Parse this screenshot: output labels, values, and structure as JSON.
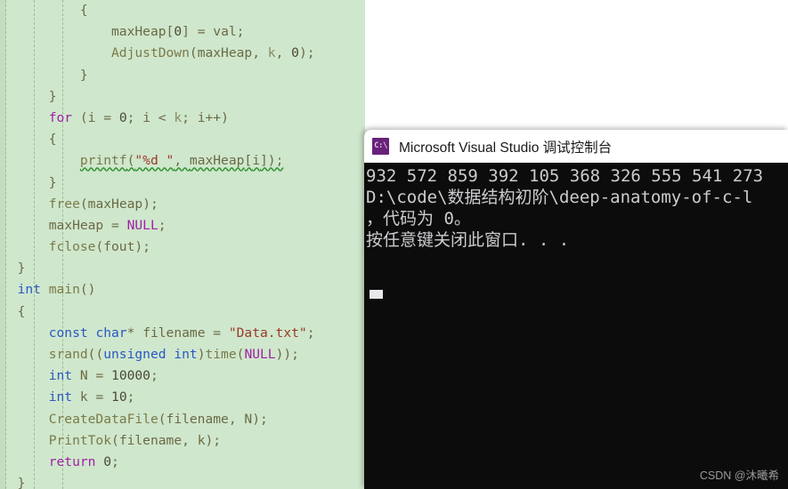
{
  "editor": {
    "name": "visual-studio-code-editor",
    "background_color": "#cfe7cc",
    "lines": [
      {
        "indent": 5,
        "segments": [
          {
            "t": "{",
            "c": "brace"
          }
        ]
      },
      {
        "indent": 7,
        "segments": [
          {
            "t": "maxHeap",
            "c": "id"
          },
          {
            "t": "[",
            "c": "punc"
          },
          {
            "t": "0",
            "c": "num"
          },
          {
            "t": "] = ",
            "c": "punc"
          },
          {
            "t": "val",
            "c": "id"
          },
          {
            "t": ";",
            "c": "punc"
          }
        ]
      },
      {
        "indent": 7,
        "segments": [
          {
            "t": "AdjustDown",
            "c": "fn"
          },
          {
            "t": "(",
            "c": "punc"
          },
          {
            "t": "maxHeap",
            "c": "id"
          },
          {
            "t": ", ",
            "c": "punc"
          },
          {
            "t": "k",
            "c": "param"
          },
          {
            "t": ", ",
            "c": "punc"
          },
          {
            "t": "0",
            "c": "num"
          },
          {
            "t": ");",
            "c": "punc"
          }
        ]
      },
      {
        "indent": 5,
        "segments": [
          {
            "t": "}",
            "c": "brace"
          }
        ]
      },
      {
        "indent": 3,
        "segments": [
          {
            "t": "}",
            "c": "brace"
          }
        ]
      },
      {
        "indent": 3,
        "segments": [
          {
            "t": "for",
            "c": "kw"
          },
          {
            "t": " (",
            "c": "punc"
          },
          {
            "t": "i",
            "c": "id"
          },
          {
            "t": " = ",
            "c": "punc"
          },
          {
            "t": "0",
            "c": "num"
          },
          {
            "t": "; ",
            "c": "punc"
          },
          {
            "t": "i",
            "c": "id"
          },
          {
            "t": " < ",
            "c": "punc"
          },
          {
            "t": "k",
            "c": "param"
          },
          {
            "t": "; ",
            "c": "punc"
          },
          {
            "t": "i",
            "c": "id"
          },
          {
            "t": "++)",
            "c": "punc"
          }
        ]
      },
      {
        "indent": 3,
        "segments": [
          {
            "t": "{",
            "c": "brace"
          }
        ]
      },
      {
        "indent": 5,
        "squiggle": true,
        "segments": [
          {
            "t": "printf",
            "c": "fn"
          },
          {
            "t": "(",
            "c": "punc"
          },
          {
            "t": "\"%d \"",
            "c": "str"
          },
          {
            "t": ", ",
            "c": "punc"
          },
          {
            "t": "maxHeap",
            "c": "id"
          },
          {
            "t": "[",
            "c": "punc"
          },
          {
            "t": "i",
            "c": "id"
          },
          {
            "t": "]);",
            "c": "punc"
          }
        ]
      },
      {
        "indent": 3,
        "segments": [
          {
            "t": "}",
            "c": "brace"
          }
        ]
      },
      {
        "indent": 3,
        "segments": [
          {
            "t": "free",
            "c": "fn"
          },
          {
            "t": "(",
            "c": "punc"
          },
          {
            "t": "maxHeap",
            "c": "id"
          },
          {
            "t": ");",
            "c": "punc"
          }
        ]
      },
      {
        "indent": 3,
        "segments": [
          {
            "t": "maxHeap",
            "c": "id"
          },
          {
            "t": " = ",
            "c": "punc"
          },
          {
            "t": "NULL",
            "c": "kw"
          },
          {
            "t": ";",
            "c": "punc"
          }
        ]
      },
      {
        "indent": 3,
        "segments": [
          {
            "t": "fclose",
            "c": "fn"
          },
          {
            "t": "(",
            "c": "punc"
          },
          {
            "t": "fout",
            "c": "id"
          },
          {
            "t": ");",
            "c": "punc"
          }
        ]
      },
      {
        "indent": 1,
        "segments": [
          {
            "t": "}",
            "c": "brace"
          }
        ]
      },
      {
        "indent": 1,
        "segments": [
          {
            "t": "int",
            "c": "type"
          },
          {
            "t": " ",
            "c": "punc"
          },
          {
            "t": "main",
            "c": "fn"
          },
          {
            "t": "()",
            "c": "punc"
          }
        ]
      },
      {
        "indent": 1,
        "segments": [
          {
            "t": "{",
            "c": "brace"
          }
        ]
      },
      {
        "indent": 3,
        "segments": [
          {
            "t": "const",
            "c": "type"
          },
          {
            "t": " ",
            "c": "punc"
          },
          {
            "t": "char",
            "c": "type"
          },
          {
            "t": "* ",
            "c": "punc"
          },
          {
            "t": "filename",
            "c": "id"
          },
          {
            "t": " = ",
            "c": "punc"
          },
          {
            "t": "\"Data.txt\"",
            "c": "str"
          },
          {
            "t": ";",
            "c": "punc"
          }
        ]
      },
      {
        "indent": 3,
        "segments": [
          {
            "t": "srand",
            "c": "fn"
          },
          {
            "t": "((",
            "c": "punc"
          },
          {
            "t": "unsigned",
            "c": "type"
          },
          {
            "t": " ",
            "c": "punc"
          },
          {
            "t": "int",
            "c": "type"
          },
          {
            "t": ")",
            "c": "punc"
          },
          {
            "t": "time",
            "c": "fn"
          },
          {
            "t": "(",
            "c": "punc"
          },
          {
            "t": "NULL",
            "c": "kw"
          },
          {
            "t": "));",
            "c": "punc"
          }
        ]
      },
      {
        "indent": 3,
        "segments": [
          {
            "t": "int",
            "c": "type"
          },
          {
            "t": " ",
            "c": "punc"
          },
          {
            "t": "N",
            "c": "id"
          },
          {
            "t": " = ",
            "c": "punc"
          },
          {
            "t": "10000",
            "c": "num"
          },
          {
            "t": ";",
            "c": "punc"
          }
        ]
      },
      {
        "indent": 3,
        "segments": [
          {
            "t": "int",
            "c": "type"
          },
          {
            "t": " ",
            "c": "punc"
          },
          {
            "t": "k",
            "c": "id"
          },
          {
            "t": " = ",
            "c": "punc"
          },
          {
            "t": "10",
            "c": "num"
          },
          {
            "t": ";",
            "c": "punc"
          }
        ]
      },
      {
        "indent": 3,
        "segments": [
          {
            "t": "CreateDataFile",
            "c": "fn"
          },
          {
            "t": "(",
            "c": "punc"
          },
          {
            "t": "filename",
            "c": "id"
          },
          {
            "t": ", ",
            "c": "punc"
          },
          {
            "t": "N",
            "c": "id"
          },
          {
            "t": ");",
            "c": "punc"
          }
        ]
      },
      {
        "indent": 3,
        "segments": [
          {
            "t": "PrintTok",
            "c": "fn"
          },
          {
            "t": "(",
            "c": "punc"
          },
          {
            "t": "filename",
            "c": "id"
          },
          {
            "t": ", ",
            "c": "punc"
          },
          {
            "t": "k",
            "c": "id"
          },
          {
            "t": ");",
            "c": "punc"
          }
        ]
      },
      {
        "indent": 3,
        "segments": [
          {
            "t": "return",
            "c": "kw"
          },
          {
            "t": " ",
            "c": "punc"
          },
          {
            "t": "0",
            "c": "num"
          },
          {
            "t": ";",
            "c": "punc"
          }
        ]
      },
      {
        "indent": 1,
        "segments": [
          {
            "t": "}",
            "c": "brace"
          }
        ]
      }
    ]
  },
  "console": {
    "title": "Microsoft Visual Studio 调试控制台",
    "icon": "command-prompt-icon",
    "icon_glyph": "C:\\",
    "titlebar_color": "#ffffff",
    "background_color": "#0c0c0c",
    "text_color": "#ccccd0",
    "lines": [
      "932 572 859 392 105 368 326 555 541 273",
      "D:\\code\\数据结构初阶\\deep-anatomy-of-c-l",
      "，代码为 0。",
      "按任意键关闭此窗口. . ."
    ]
  },
  "watermark": {
    "text": "CSDN @沐曦希"
  }
}
